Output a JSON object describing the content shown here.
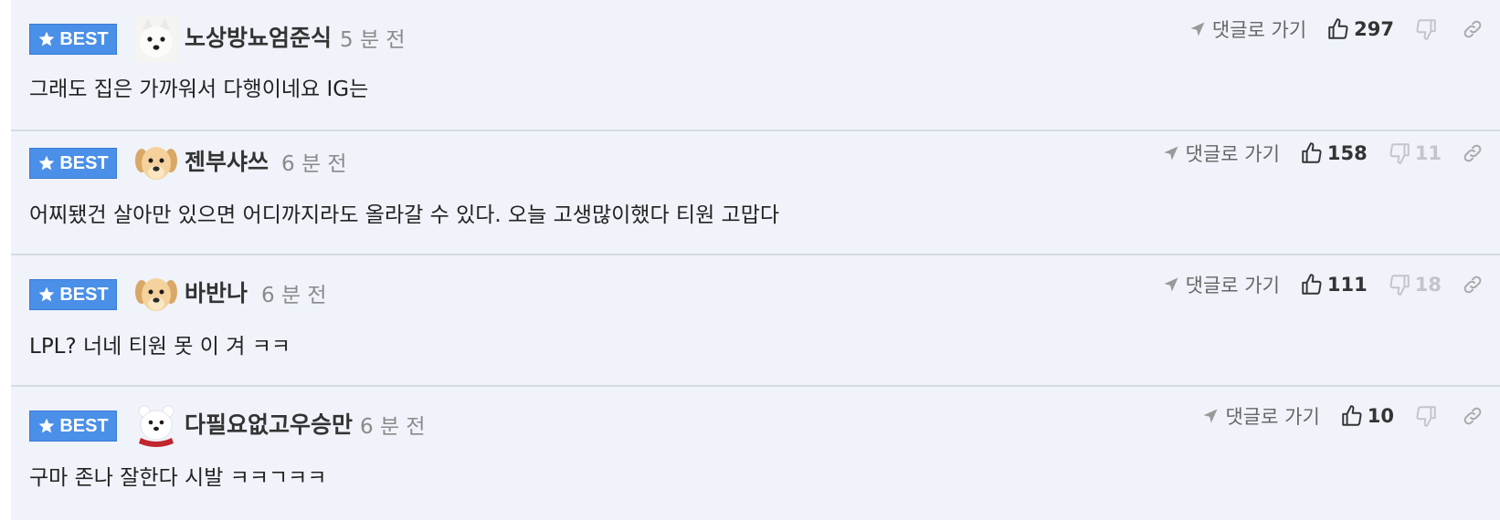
{
  "colors": {
    "badge": "#4a8fe8",
    "background": "#f0f3fa",
    "divider": "#d6dbe3",
    "time_text": "#8a8a8a",
    "dislike_text": "#c2c5cc"
  },
  "comments": [
    {
      "badge_label": "BEST",
      "avatar_icon": "white-dog-avatar",
      "nickname": "노상방뇨엄준식",
      "time": "5 분 전",
      "body": "그래도 집은 가까워서 다행이네요 IG는",
      "goto_label": "댓글로 가기",
      "likes": "297",
      "dislikes": ""
    },
    {
      "badge_label": "BEST",
      "avatar_icon": "puppy-avatar",
      "nickname": "젠부샤쓰",
      "time": "6 분 전",
      "body": "어찌됐건 살아만 있으면 어디까지라도 올라갈 수 있다. 오늘 고생많이했다 티원 고맙다",
      "goto_label": "댓글로 가기",
      "likes": "158",
      "dislikes": "11"
    },
    {
      "badge_label": "BEST",
      "avatar_icon": "puppy-avatar",
      "nickname": "바반나",
      "time": "6 분 전",
      "body": "LPL? 너네 티원 못 이 겨 ㅋㅋ",
      "goto_label": "댓글로 가기",
      "likes": "111",
      "dislikes": "18"
    },
    {
      "badge_label": "BEST",
      "avatar_icon": "polar-bear-avatar",
      "nickname": "다필요없고우승만",
      "time": "6 분 전",
      "body": "구마 존나 잘한다 시발 ㅋㅋㄱㅋㅋ",
      "goto_label": "댓글로 가기",
      "likes": "10",
      "dislikes": ""
    }
  ]
}
